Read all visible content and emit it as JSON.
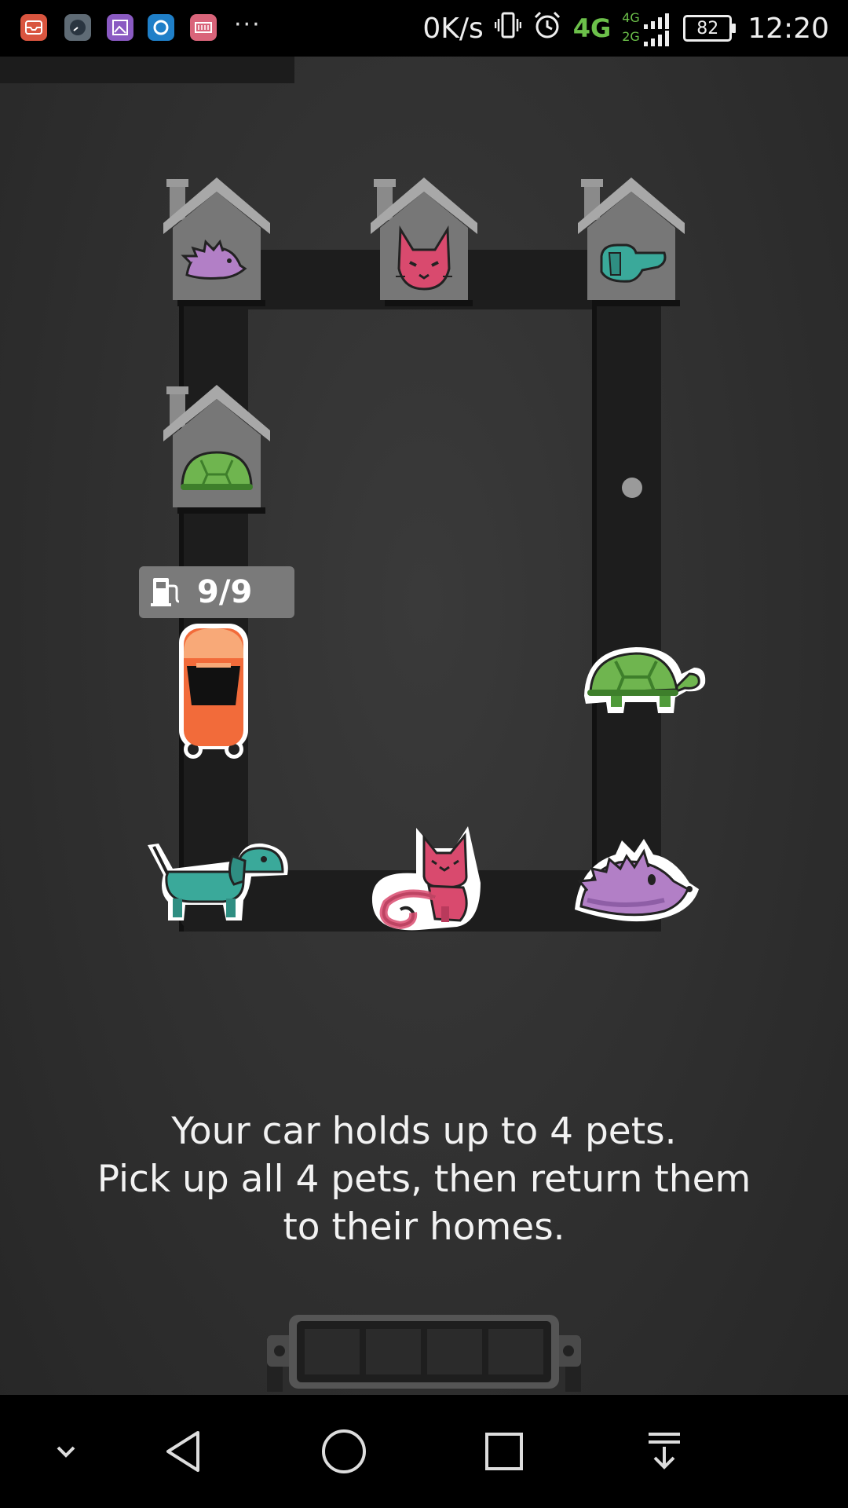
{
  "status_bar": {
    "net_speed": "0K/s",
    "network_type": "4G",
    "network_type_secondary": "4G",
    "network_type_tertiary": "2G",
    "battery_level": "82",
    "time": "12:20",
    "overflow": "···",
    "app_icons": [
      "mail-app-icon",
      "clock-app-icon",
      "gallery-app-icon",
      "browser-app-icon",
      "video-app-icon"
    ]
  },
  "game": {
    "fuel": "9/9",
    "car_capacity": 4,
    "houses": [
      "hedgehog-house",
      "cat-house",
      "dog-house",
      "turtle-house"
    ],
    "pets_on_road": [
      "turtle",
      "dachshund-dog",
      "cat",
      "hedgehog"
    ],
    "cargo_slots_filled": 0,
    "cargo_slots_total": 4
  },
  "instructions": {
    "line1": "Your car holds up to 4 pets.",
    "line2": "Pick up all 4 pets, then return them",
    "line3": "to their homes."
  },
  "nav_bar": {
    "buttons": [
      "hide-bar",
      "back",
      "home",
      "recents",
      "notifications"
    ]
  },
  "colors": {
    "background": "#2f2f2f",
    "road": "#1d1d1d",
    "car": "#f26b3a",
    "hedgehog": "#b27fc6",
    "cat": "#d94a6e",
    "dog": "#3aa99a",
    "turtle": "#6fb54f",
    "house": "#777777"
  }
}
